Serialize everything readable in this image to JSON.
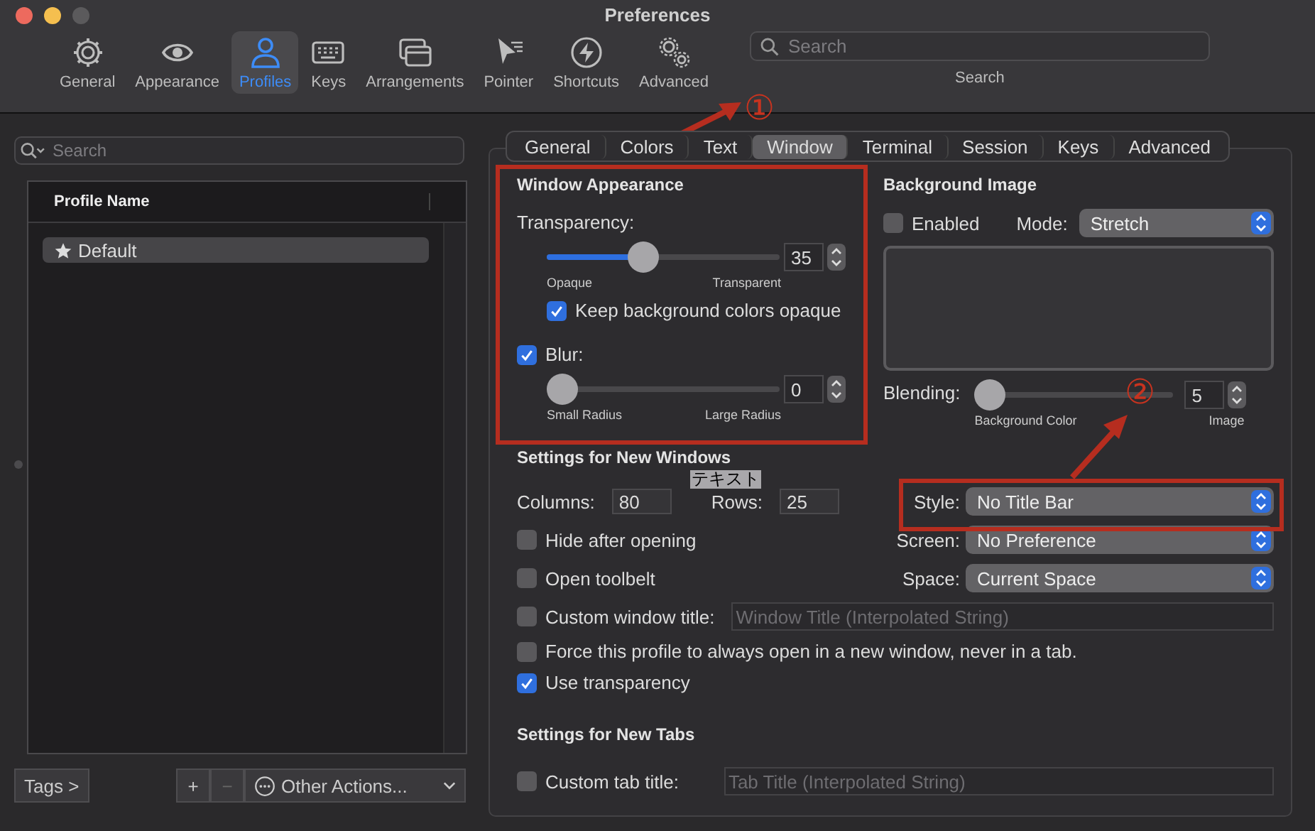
{
  "window": {
    "title": "Preferences"
  },
  "toolbar": [
    {
      "label": "General",
      "kind": "gear",
      "selected": false
    },
    {
      "label": "Appearance",
      "kind": "eye",
      "selected": false
    },
    {
      "label": "Profiles",
      "kind": "person",
      "selected": true
    },
    {
      "label": "Keys",
      "kind": "keyboard",
      "selected": false
    },
    {
      "label": "Arrangements",
      "kind": "windows",
      "selected": false
    },
    {
      "label": "Pointer",
      "kind": "pointer",
      "selected": false
    },
    {
      "label": "Shortcuts",
      "kind": "bolt",
      "selected": false
    },
    {
      "label": "Advanced",
      "kind": "gears",
      "selected": false
    }
  ],
  "toolbar_search": {
    "placeholder": "Search",
    "label": "Search"
  },
  "profiles": {
    "search_placeholder": "Search",
    "column": "Profile Name",
    "items": [
      {
        "name": "Default",
        "starred": true,
        "selected": true
      }
    ],
    "tags_button": "Tags >",
    "add_button": "+",
    "remove_button": "−",
    "other_actions": "Other Actions..."
  },
  "tabs": [
    {
      "label": "General",
      "selected": false
    },
    {
      "label": "Colors",
      "selected": false
    },
    {
      "label": "Text",
      "selected": false
    },
    {
      "label": "Window",
      "selected": true
    },
    {
      "label": "Terminal",
      "selected": false
    },
    {
      "label": "Session",
      "selected": false
    },
    {
      "label": "Keys",
      "selected": false
    },
    {
      "label": "Advanced",
      "selected": false
    }
  ],
  "window_appearance": {
    "title": "Window Appearance",
    "transparency": {
      "label": "Transparency:",
      "level": 0.4,
      "value": "35",
      "min_label": "Opaque",
      "max_label": "Transparent"
    },
    "keep_opaque": {
      "label": "Keep background colors opaque",
      "checked": true
    },
    "blur": {
      "label": "Blur:",
      "checked": true,
      "level": 0,
      "value": "0",
      "min_label": "Small Radius",
      "max_label": "Large Radius"
    }
  },
  "background_image": {
    "title": "Background Image",
    "enabled": {
      "label": "Enabled",
      "checked": false
    },
    "mode_label": "Mode:",
    "mode": "Stretch",
    "blending": {
      "label": "Blending:",
      "level": 0,
      "value": "5",
      "min_label": "Background Color",
      "max_label": "Image"
    }
  },
  "new_windows": {
    "title": "Settings for New Windows",
    "columns_label": "Columns:",
    "columns": "80",
    "rows_label": "Rows:",
    "rows": "25",
    "popups": [
      {
        "label": "Style:",
        "value": "No Title Bar"
      },
      {
        "label": "Screen:",
        "value": "No Preference"
      },
      {
        "label": "Space:",
        "value": "Current Space"
      }
    ],
    "options": [
      {
        "label": "Hide after opening",
        "checked": false
      },
      {
        "label": "Open toolbelt",
        "checked": false
      },
      {
        "label": "Custom window title:",
        "checked": false,
        "placeholder": "Window Title (Interpolated String)"
      },
      {
        "label": "Force this profile to always open in a new window, never in a tab.",
        "checked": false
      },
      {
        "label": "Use transparency",
        "checked": true
      }
    ]
  },
  "new_tabs": {
    "title": "Settings for New Tabs",
    "options": [
      {
        "label": "Custom tab title:",
        "checked": false,
        "placeholder": "Tab Title (Interpolated String)"
      }
    ]
  },
  "annotations": {
    "markers": [
      {
        "label": "①"
      },
      {
        "label": "②"
      }
    ],
    "note": "テキスト"
  }
}
